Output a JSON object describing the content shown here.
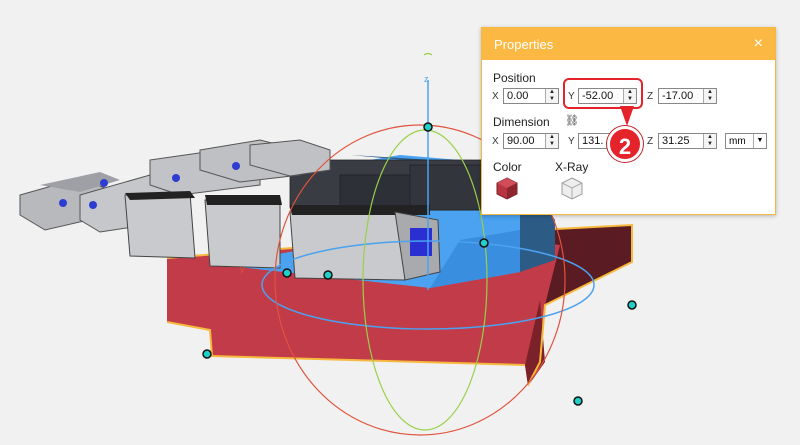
{
  "properties": {
    "title": "Properties",
    "close_label": "×",
    "position": {
      "label": "Position",
      "x_label": "X",
      "x": "0.00",
      "y_label": "Y",
      "y": "-52.00",
      "z_label": "Z",
      "z": "-17.00"
    },
    "dimension": {
      "label": "Dimension",
      "x_label": "X",
      "x": "90.00",
      "y_label": "Y",
      "y": "131.",
      "z_label": "Z",
      "z": "31.25",
      "unit": "mm"
    },
    "color": {
      "label": "Color",
      "value": "#b8343f"
    },
    "xray": {
      "label": "X-Ray"
    }
  },
  "viewport": {
    "axis_z_label": "z",
    "axis_y_label": "y"
  },
  "annotation": {
    "step_number": "2",
    "highlight_color": "#e5232a"
  }
}
